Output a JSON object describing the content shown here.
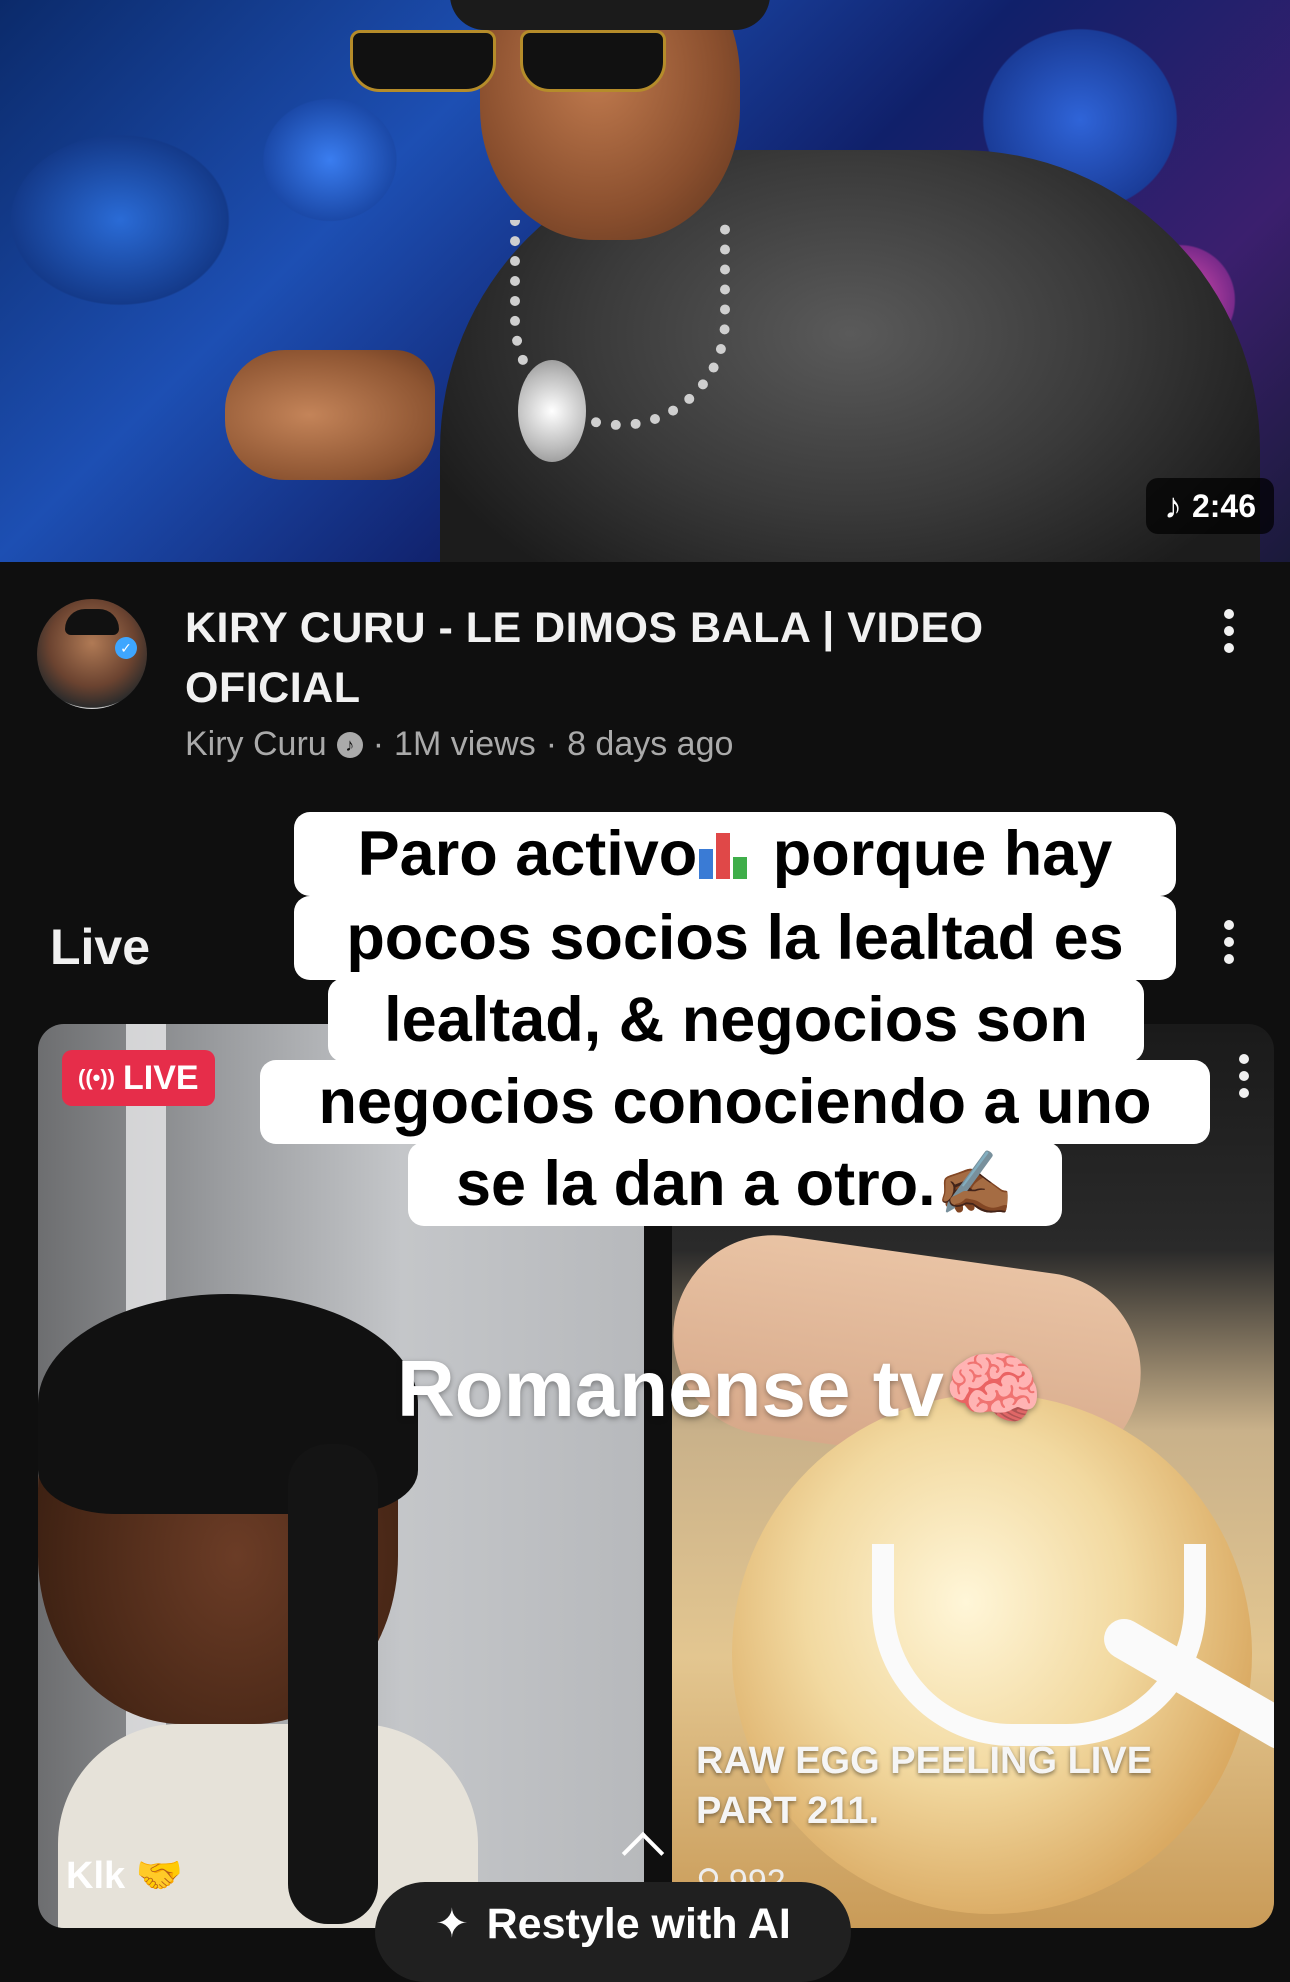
{
  "video": {
    "duration": "2:46",
    "title": "KIRY CURU - LE DIMOS BALA | VIDEO OFICIAL",
    "channel": "Kiry Curu",
    "views": "1M views",
    "age": "8 days ago",
    "meta_sep": "·"
  },
  "live_section": {
    "heading": "Live",
    "cards": [
      {
        "badge": "LIVE",
        "name": "Klk 🤝"
      },
      {
        "title": "RAW EGG PEELING LIVE PART 211.",
        "viewers": "992"
      }
    ]
  },
  "caption": {
    "line1_a": "Paro activo",
    "line1_b": " porque hay",
    "line2": "pocos socios la lealtad es",
    "line3": "lealtad, & negocios son",
    "line4": "negocios conociendo a uno",
    "line5": "se la dan a otro.✍🏾"
  },
  "watermark": "Romanense tv🧠",
  "restyle_button": "Restyle with AI",
  "icons": {
    "music": "music-note-icon",
    "more": "more-vertical-icon",
    "live_waves": "live-broadcast-icon",
    "viewer": "person-icon",
    "sparkle": "sparkle-icon",
    "chevron": "chevron-up-icon"
  },
  "colors": {
    "background": "#0f0f0f",
    "live_badge": "#e62d4a",
    "meta_text": "#aaaaaa"
  }
}
